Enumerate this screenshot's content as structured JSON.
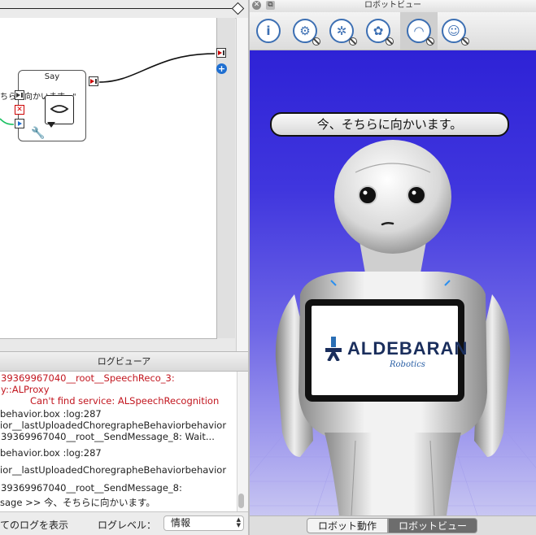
{
  "flow": {
    "say_box": {
      "title": "Say",
      "comment": "ちらに向かいます。\""
    }
  },
  "log_viewer": {
    "title": "ログビューア",
    "lines": [
      {
        "text": "39369967040__root__SpeechReco_3:",
        "type": "error"
      },
      {
        "text": "y::ALProxy",
        "type": "error"
      },
      {
        "text": "Can't find service: ALSpeechRecognition",
        "type": "error"
      },
      {
        "text": " behavior.box :log:287",
        "type": "info"
      },
      {
        "text": "ior__lastUploadedChoregrapheBehaviorbehavior",
        "type": "info"
      },
      {
        "text": "39369967040__root__SendMessage_8: Wait...",
        "type": "info"
      },
      {
        "text": " behavior.box :log:287",
        "type": "info"
      },
      {
        "text": "ior__lastUploadedChoregrapheBehaviorbehavior",
        "type": "info"
      },
      {
        "text": "39369967040__root__SendMessage_8:",
        "type": "info"
      },
      {
        "text": "sage >> 今、そちらに向かいます。",
        "type": "info"
      }
    ],
    "footer": {
      "show_all_label": "てのログを表示",
      "level_label": "ログレベル：",
      "level_value": "情報"
    }
  },
  "robot_view": {
    "window_title": "ロボットビュー",
    "toolbar": [
      {
        "icon": "info-icon",
        "glyph": "i"
      },
      {
        "icon": "joints-icon",
        "glyph": "⚙"
      },
      {
        "icon": "collision-icon",
        "glyph": "✲"
      },
      {
        "icon": "settings-icon",
        "glyph": "✿"
      },
      {
        "icon": "dashboard-icon",
        "glyph": "◠"
      },
      {
        "icon": "face-icon",
        "glyph": "☺"
      }
    ],
    "speech_bubble": "今、そちらに向かいます。",
    "tablet_logo": {
      "name": "ALDEBARAN",
      "sub": "Robotics"
    },
    "tabs": [
      "ロボット動作",
      "ロボットビュー"
    ],
    "active_tab": "ロボットビュー",
    "colors": {
      "scene_top": "#2e22d6",
      "scene_bottom": "#c8c6f2",
      "error_text": "#c2161f",
      "accent": "#3c6fb3"
    }
  }
}
